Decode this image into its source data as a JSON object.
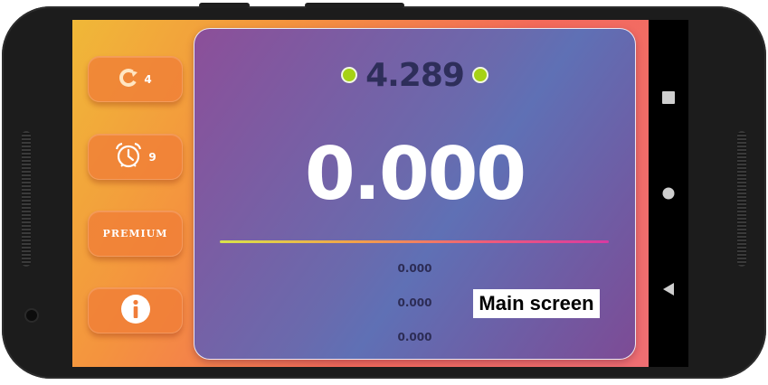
{
  "side_buttons": {
    "restart": {
      "count": "4",
      "icon": "restart-icon"
    },
    "alarm": {
      "count": "9",
      "icon": "alarm-clock-icon"
    },
    "premium": {
      "label": "PREMIUM"
    },
    "info": {
      "icon": "info-icon"
    }
  },
  "timer": {
    "best": "4.289",
    "current": "0.000",
    "laps": [
      "0.000",
      "0.000",
      "0.000"
    ]
  },
  "caption": "Main screen",
  "system_nav": [
    "recents-square-icon",
    "home-circle-icon",
    "back-triangle-icon"
  ],
  "colors": {
    "background_gradient": [
      "#f0b838",
      "#f36a5a",
      "#ef6e73"
    ],
    "card_gradient": [
      "#8c4f99",
      "#5f70b5",
      "#7d4b95"
    ],
    "dot": "#a6d115",
    "best_text": "#2e2e5a"
  }
}
